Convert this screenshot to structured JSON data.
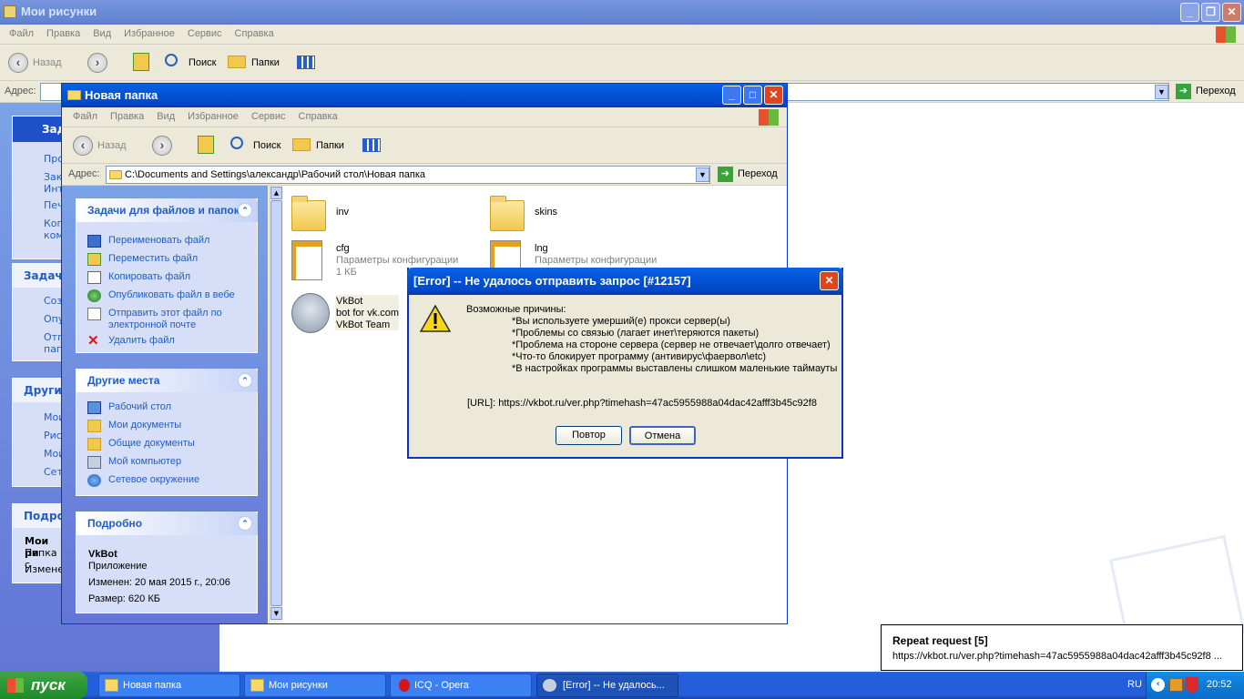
{
  "bg_window": {
    "title": "Мои рисунки",
    "menu": [
      "Файл",
      "Правка",
      "Вид",
      "Избранное",
      "Сервис",
      "Справка"
    ],
    "toolbar": {
      "back": "Назад",
      "search": "Поиск",
      "folders": "Папки"
    },
    "address_label": "Адрес:",
    "go_label": "Переход",
    "sidebar_fragments": {
      "tasks_head": "Зад",
      "task_items": [
        "Про",
        "Зак",
        "Инт",
        "Печ",
        "Коп",
        "ком"
      ],
      "tasks2_head": "Задачи",
      "tasks2_items": [
        "Соз",
        "Опу",
        "Отп",
        "пап"
      ],
      "other_head": "Други",
      "other_items": [
        "Мои",
        "Рис",
        "Мой",
        "Сет"
      ],
      "details_head": "Подроб",
      "details_items": [
        "Мои ри",
        "Папка с",
        "Изменен"
      ]
    }
  },
  "fg_window": {
    "title": "Новая папка",
    "menu": [
      "Файл",
      "Правка",
      "Вид",
      "Избранное",
      "Сервис",
      "Справка"
    ],
    "toolbar": {
      "back": "Назад",
      "search": "Поиск",
      "folders": "Папки"
    },
    "address_label": "Адрес:",
    "address_value": "C:\\Documents and Settings\\александр\\Рабочий стол\\Новая папка",
    "go_label": "Переход",
    "file_tasks": {
      "title": "Задачи для файлов и папок",
      "items": [
        "Переименовать файл",
        "Переместить файл",
        "Копировать файл",
        "Опубликовать файл в вебе",
        "Отправить этот файл по",
        "электронной почте",
        "Удалить файл"
      ]
    },
    "other_places": {
      "title": "Другие места",
      "items": [
        "Рабочий стол",
        "Мои документы",
        "Общие документы",
        "Мой компьютер",
        "Сетевое окружение"
      ]
    },
    "details": {
      "title": "Подробно",
      "name": "VkBot",
      "type": "Приложение",
      "modified": "Изменен: 20 мая 2015 г., 20:06",
      "size": "Размер: 620 КБ"
    },
    "files": [
      {
        "name": "inv"
      },
      {
        "name": "skins"
      },
      {
        "name": "cfg",
        "desc": "Параметры конфигурации",
        "size": "1 КБ"
      },
      {
        "name": "lng",
        "desc": "Параметры конфигурации"
      },
      {
        "name": "VkBot",
        "desc": "bot for vk.com",
        "company": "VkBot Team"
      }
    ]
  },
  "dialog": {
    "title": "[Error] -- Не удалось отправить запрос [#12157]",
    "heading": "Возможные причины:",
    "reasons": [
      "*Вы используете умерший(е) прокси сервер(ы)",
      "*Проблемы со связью (лагает инет\\теряются пакеты)",
      "*Проблема на стороне сервера (сервер не отвечает\\долго отвечает)",
      "*Что-то блокирует программу (антивирус\\фаервол\\etc)",
      "*В настройках программы выставлены слишком маленькие таймауты"
    ],
    "url_line": "[URL]: https://vkbot.ru/ver.php?timehash=47ac5955988a04dac42afff3b45c92f8",
    "retry": "Повтор",
    "cancel": "Отмена"
  },
  "notification": {
    "title": "Repeat request [5]",
    "text": "https://vkbot.ru/ver.php?timehash=47ac5955988a04dac42afff3b45c92f8 ..."
  },
  "taskbar": {
    "start": "пуск",
    "buttons": [
      "Новая папка",
      "Мои рисунки",
      "ICQ - Opera",
      "[Error] -- Не удалось..."
    ],
    "lang": "RU",
    "clock": "20:52"
  }
}
